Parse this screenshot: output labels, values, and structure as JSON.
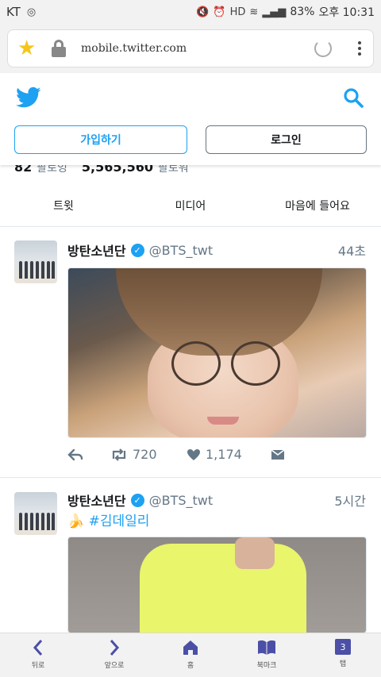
{
  "status_bar": {
    "carrier": "KT",
    "battery": "83%",
    "time": "오후 10:31",
    "icons": [
      "mute-icon",
      "alarm-icon",
      "hd-icon",
      "wifi-icon",
      "signal-icon",
      "battery-icon"
    ]
  },
  "browser": {
    "url": "mobile.twitter.com",
    "icons": [
      "star-icon",
      "lock-icon",
      "reload-icon",
      "menu-icon"
    ]
  },
  "twitter_header": {
    "signup_label": "가입하기",
    "login_label": "로그인"
  },
  "profile_stats": {
    "following_count": "82",
    "following_label": "팔로잉",
    "followers_count": "5,565,560",
    "followers_label": "팔로워"
  },
  "profile_tabs": [
    "트윗",
    "미디어",
    "마음에 들어요"
  ],
  "tweets": [
    {
      "name": "방탄소년단",
      "handle": "@BTS_twt",
      "time": "44초",
      "retweets": "720",
      "likes": "1,174"
    },
    {
      "name": "방탄소년단",
      "handle": "@BTS_twt",
      "time": "5시간",
      "text": "🍌 #김데일리"
    }
  ],
  "bottom_nav": [
    {
      "label": "뒤로",
      "icon": "back-icon"
    },
    {
      "label": "앞으로",
      "icon": "forward-icon"
    },
    {
      "label": "홈",
      "icon": "home-icon"
    },
    {
      "label": "북마크",
      "icon": "bookmark-icon"
    },
    {
      "label": "탭",
      "icon": "tabs-icon",
      "count": "3"
    }
  ],
  "colors": {
    "twitter_blue": "#1da1f2",
    "nav_purple": "#4b4fa6",
    "secondary_text": "#657786"
  }
}
